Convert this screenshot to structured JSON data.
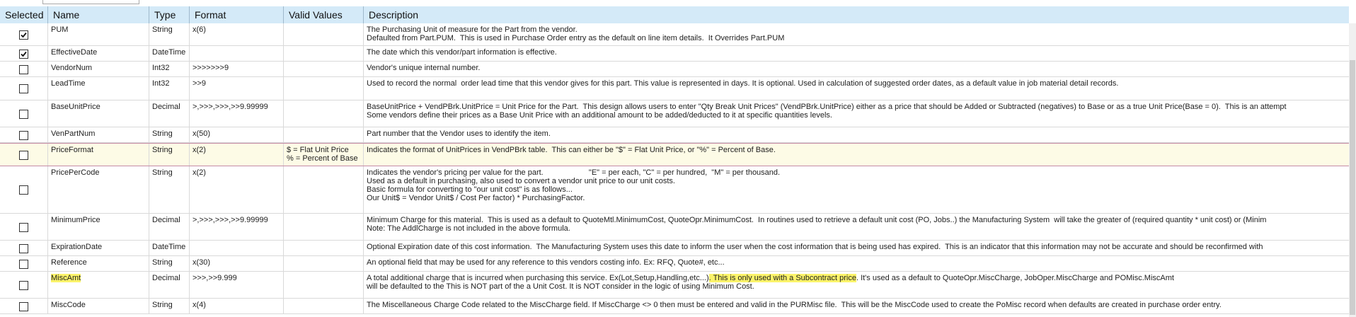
{
  "columns": [
    "Selected",
    "Name",
    "Type",
    "Format",
    "Valid Values",
    "Description"
  ],
  "rows": [
    {
      "selected": true,
      "name": "PUM",
      "type": "String",
      "format": "x(6)",
      "valid": [],
      "desc": [
        "The Purchasing Unit of measure for the Part from the vendor.",
        "Defaulted from Part.PUM.  This is used in Purchase Order entry as the default on line item details.  It Overrides Part.PUM"
      ]
    },
    {
      "selected": true,
      "name": "EffectiveDate",
      "type": "DateTime",
      "format": "",
      "valid": [],
      "desc": [
        "The date which this vendor/part information is effective."
      ]
    },
    {
      "selected": false,
      "name": "VendorNum",
      "type": "Int32",
      "format": ">>>>>>>9",
      "valid": [],
      "desc": [
        "Vendor's unique internal number."
      ]
    },
    {
      "selected": false,
      "name": "LeadTime",
      "type": "Int32",
      "format": ">>9",
      "valid": [],
      "desc": [
        "Used to record the normal  order lead time that this vendor gives for this part. This value is represented in days. It is optional. Used in calculation of suggested order dates, as a default value in job material detail records."
      ]
    },
    {
      "selected": false,
      "name": "BaseUnitPrice",
      "type": "Decimal",
      "format": ">,>>>,>>>,>>9.99999",
      "valid": [],
      "desc": [
        "BaseUnitPrice + VendPBrk.UnitPrice = Unit Price for the Part.  This design allows users to enter \"Qty Break Unit Prices\" (VendPBrk.UnitPrice) either as a price that should be Added or Subtracted (negatives) to Base or as a true Unit Price(Base = 0).  This is an attempt",
        "Some vendors define their prices as a Base Unit Price with an additional amount to be added/deducted to it at specific quantities levels."
      ]
    },
    {
      "selected": false,
      "name": "VenPartNum",
      "type": "String",
      "format": "x(50)",
      "valid": [],
      "desc": [
        "Part number that the Vendor uses to identify the item."
      ]
    },
    {
      "selected": false,
      "name": "PriceFormat",
      "type": "String",
      "format": "x(2)",
      "valid": [
        "$ = Flat Unit Price",
        "% = Percent of Base"
      ],
      "desc": [
        "Indicates the format of UnitPrices in VendPBrk table.  This can either be \"$\" = Flat Unit Price, or \"%\" = Percent of Base."
      ]
    },
    {
      "selected": false,
      "name": "PricePerCode",
      "type": "String",
      "format": "x(2)",
      "valid": [],
      "desc": [
        "Indicates the vendor's pricing per value for the part.                     \"E\" = per each, \"C\" = per hundred,  \"M\" = per thousand.",
        "Used as a default in purchasing, also used to convert a vendor unit price to our unit costs.",
        "Basic formula for converting to \"our unit cost\" is as follows...",
        "Our Unit$ = Vendor Unit$ / Cost Per factor) * PurchasingFactor."
      ]
    },
    {
      "selected": false,
      "name": "MinimumPrice",
      "type": "Decimal",
      "format": ">,>>>,>>>,>>9.99999",
      "valid": [],
      "desc": [
        "Minimum Charge for this material.  This is used as a default to QuoteMtl.MinimumCost, QuoteOpr.MinimumCost.  In routines used to retrieve a default unit cost (PO, Jobs..) the Manufacturing System  will take the greater of (required quantity * unit cost) or (Minim",
        "Note: The AddlCharge is not included in the above formula."
      ]
    },
    {
      "selected": false,
      "name": "ExpirationDate",
      "type": "DateTime",
      "format": "",
      "valid": [],
      "desc": [
        "Optional Expiration date of this cost information.  The Manufacturing System uses this date to inform the user when the cost information that is being used has expired.  This is an indicator that this information may not be accurate and should be reconfirmed with"
      ]
    },
    {
      "selected": false,
      "name": "Reference",
      "type": "String",
      "format": "x(30)",
      "valid": [],
      "desc": [
        "An optional field that may be used for any reference to this vendors costing info. Ex: RFQ, Quote#, etc..."
      ]
    },
    {
      "selected": false,
      "name": "MiscAmt",
      "type": "Decimal",
      "format": ">>>,>>9.999",
      "valid": [],
      "desc_a": "A total additional charge that is incurred when purchasing this service. Ex(Lot,Setup,Handling,etc...)",
      "desc_hl": ". This is only used with a Subcontract price",
      "desc_b": ". It's used as a default to QuoteOpr.MiscCharge, JobOper.MiscCharge and POMisc.MiscAmt",
      "desc": [
        "will be defaulted to the This is NOT part of the a Unit Cost. It is NOT consider in the logic of using Minimum Cost."
      ]
    },
    {
      "selected": false,
      "name": "MiscCode",
      "type": "String",
      "format": "x(4)",
      "valid": [],
      "desc": [
        "The Miscellaneous Charge Code related to the MiscCharge field. If MiscCharge <> 0 then must be entered and valid in the PURMisc file.  This will be the MiscCode used to create the PoMisc record when defaults are created in purchase order entry."
      ]
    }
  ]
}
